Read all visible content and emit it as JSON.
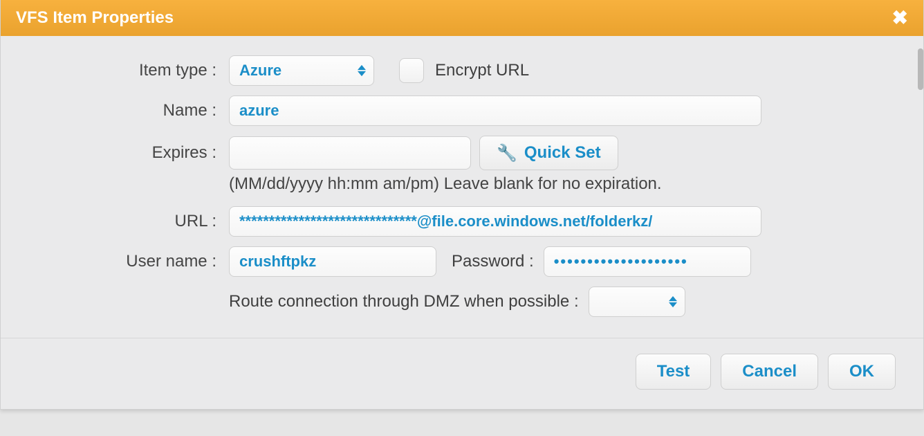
{
  "dialog": {
    "title": "VFS Item Properties"
  },
  "form": {
    "item_type_label": "Item type :",
    "item_type_value": "Azure",
    "encrypt_url_label": "Encrypt URL",
    "name_label": "Name :",
    "name_value": "azure",
    "expires_label": "Expires :",
    "expires_value": "",
    "quickset_label": "Quick Set",
    "expires_helper": "(MM/dd/yyyy hh:mm am/pm) Leave blank for no expiration.",
    "url_label": "URL :",
    "url_value": "******************************@file.core.windows.net/folderkz/",
    "username_label": "User name :",
    "username_value": "crushftpkz",
    "password_label": "Password :",
    "password_value": "••••••••••••••••••••",
    "dmz_label": "Route connection through DMZ when possible :",
    "dmz_value": ""
  },
  "footer": {
    "test": "Test",
    "cancel": "Cancel",
    "ok": "OK"
  }
}
